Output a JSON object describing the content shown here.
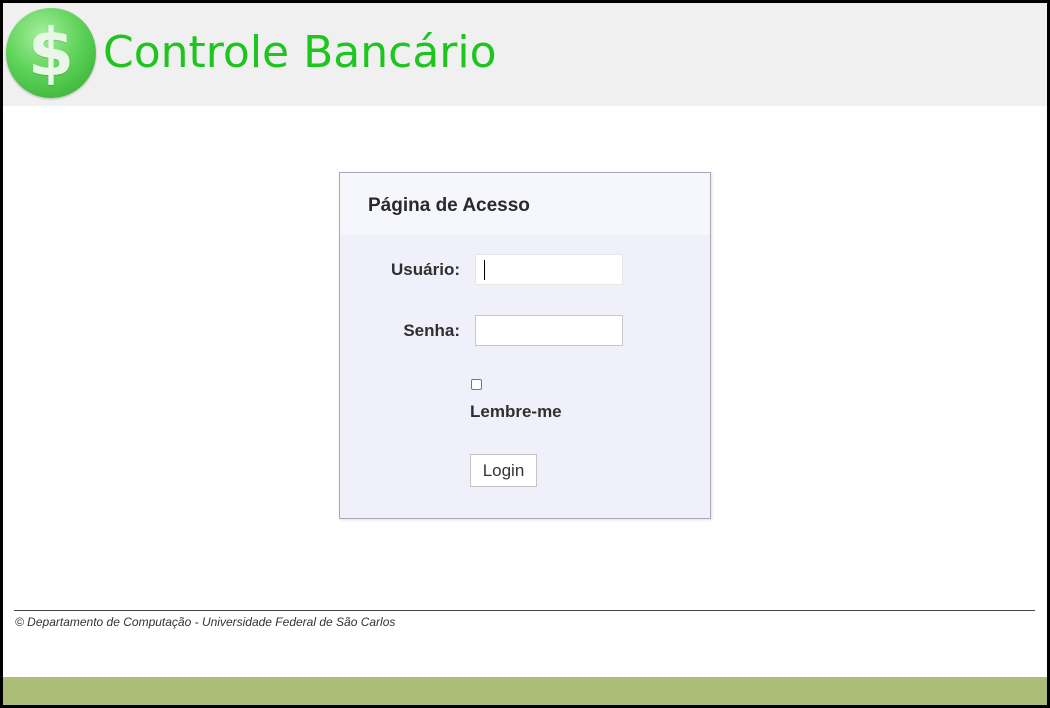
{
  "header": {
    "logo_symbol": "$",
    "title": "Controle Bancário",
    "title_color": "#1ec51e",
    "background": "#f0f0f0"
  },
  "login": {
    "heading": "Página de Acesso",
    "username_label": "Usuário:",
    "username_value": "",
    "password_label": "Senha:",
    "password_value": "",
    "remember_label": "Lembre-me",
    "remember_checked": false,
    "submit_label": "Login"
  },
  "footer": {
    "text": "© Departamento de Computação - Universidade Federal de São Carlos",
    "bar_color": "#acbd78"
  }
}
